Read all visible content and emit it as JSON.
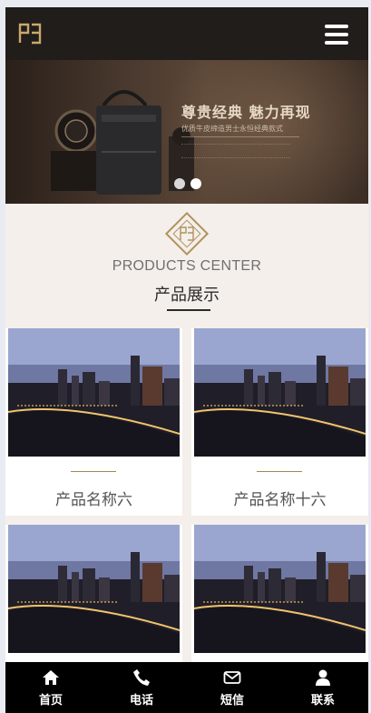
{
  "banner": {
    "title": "尊贵经典 魅力再现",
    "subtitle": "优质牛皮缔造男士永恒经典款式"
  },
  "products_section": {
    "title_en": "PRODUCTS CENTER",
    "title_cn": "产品展示"
  },
  "products": [
    {
      "name": "产品名称六"
    },
    {
      "name": "产品名称十六"
    },
    {
      "name": ""
    },
    {
      "name": ""
    }
  ],
  "bottom_nav": [
    {
      "label": "首页",
      "icon": "home-icon"
    },
    {
      "label": "电话",
      "icon": "phone-icon"
    },
    {
      "label": "短信",
      "icon": "mail-icon"
    },
    {
      "label": "联系",
      "icon": "user-icon"
    }
  ],
  "colors": {
    "header_bg": "#201d1b",
    "accent_gold": "#b0925e",
    "page_bg": "#f4efeb",
    "nav_bg": "#000000"
  }
}
